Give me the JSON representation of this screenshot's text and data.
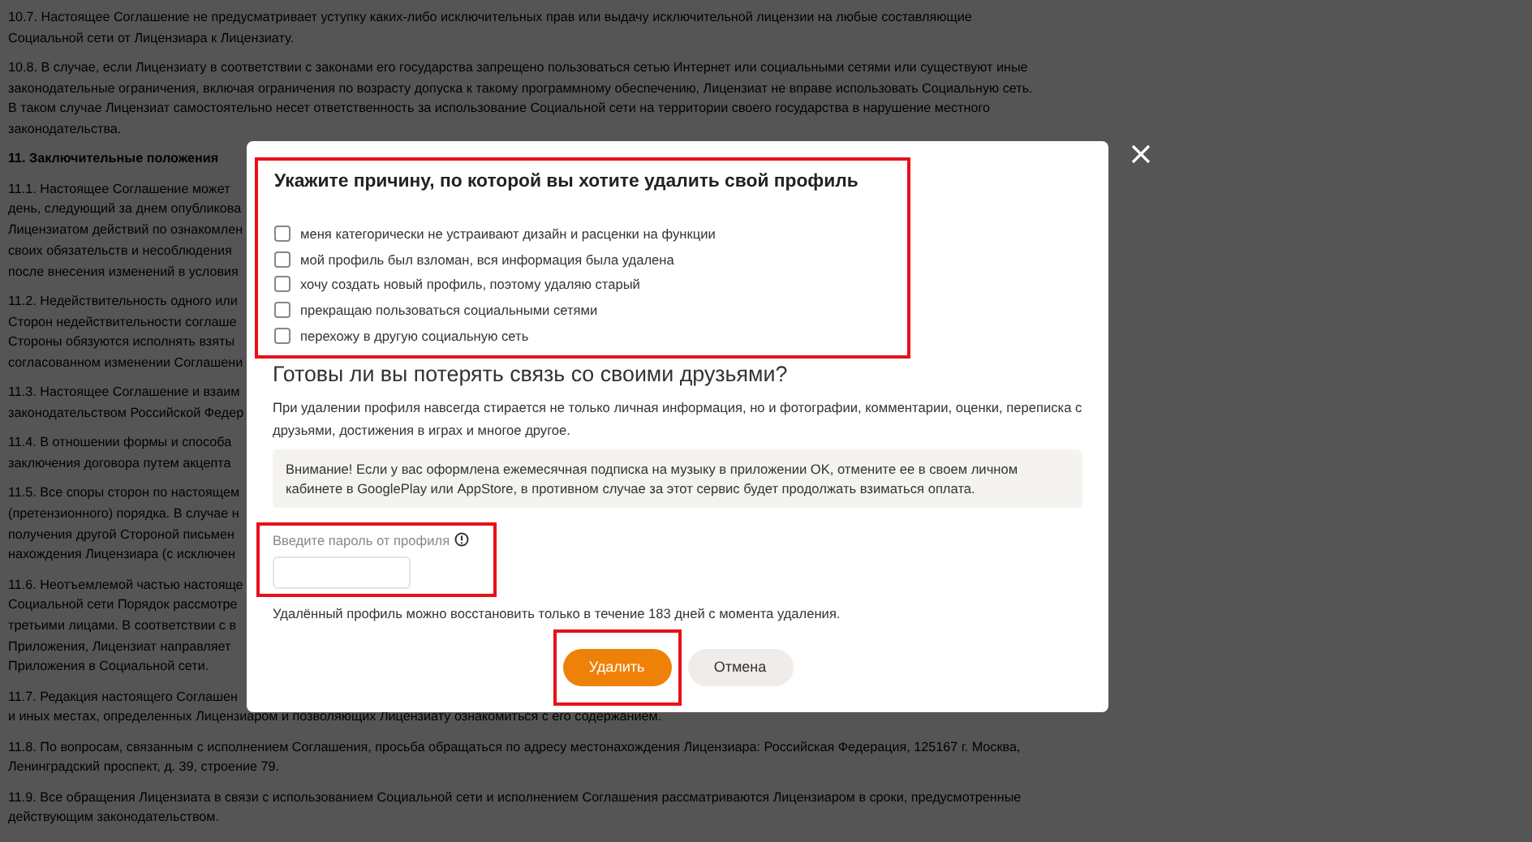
{
  "page": {
    "sections": [
      {
        "kind": "paragraph",
        "lines": [
          "10.7. Настоящее Соглашение не предусматривает уступку каких-либо исключительных прав или выдачу исключительной лицензии на любые составляющие",
          "Социальной сети от Лицензиара к Лицензиату."
        ]
      },
      {
        "kind": "paragraph",
        "lines": [
          "10.8. В случае, если Лицензиату в соответствии с законами его государства запрещено пользоваться сетью Интернет или социальными сетями или существуют иные",
          "законодательные ограничения, включая ограничения по возрасту допуска к такому программному обеспечению, Лицензиат не вправе использовать Социальную сеть.",
          "В таком случае Лицензиат самостоятельно несет ответственность за использование Социальной сети на территории своего государства в нарушение местного",
          "законодательства."
        ]
      },
      {
        "kind": "heading",
        "lines": [
          "11. Заключительные положения"
        ]
      },
      {
        "kind": "paragraph",
        "lines": [
          "11.1. Настоящее Соглашение может",
          "день, следующий за днем опубликова",
          "Лицензиатом действий по ознакомлен",
          "своих обязательств и несоблюдения",
          "после внесения изменений в условия"
        ]
      },
      {
        "kind": "paragraph",
        "lines": [
          "11.2. Недействительность одного или",
          "Сторон недействительности соглаше",
          "Стороны обязуются исполнять взяты",
          "согласованном изменении Соглашени"
        ]
      },
      {
        "kind": "paragraph",
        "lines": [
          "11.3. Настоящее Соглашение и взаим",
          "законодательством Российской Федер"
        ]
      },
      {
        "kind": "paragraph",
        "lines": [
          "11.4. В отношении формы и способа",
          "заключения договора путем акцепта"
        ]
      },
      {
        "kind": "paragraph",
        "lines": [
          "11.5. Все споры сторон по настоящем",
          "(претензионного) порядка. В случае н",
          "получения другой Стороной письмен",
          "нахождения Лицензиара (с исключен"
        ]
      },
      {
        "kind": "paragraph",
        "lines": [
          "11.6. Неотъемлемой частью настояще",
          "Социальной сети Порядок рассмотре",
          "третьими лицами. В соответствии с в",
          "Приложения, Лицензиат направляет",
          "Приложения в Социальной сети."
        ]
      },
      {
        "kind": "paragraph",
        "lines": [
          "11.7. Редакция настоящего Соглашен",
          "и иных местах, определенных Лицензиаром и позволяющих Лицензиату ознакомиться с его содержанием."
        ]
      },
      {
        "kind": "paragraph",
        "lines": [
          "11.8. По вопросам, связанным с исполнением Соглашения, просьба обращаться по адресу местонахождения Лицензиара: Российская Федерация, 125167 г. Москва,",
          "Ленинградский проспект, д. 39, строение 79."
        ]
      },
      {
        "kind": "paragraph",
        "lines": [
          "11.9. Все обращения Лицензиата в связи с использованием Социальной сети и исполнением Соглашения рассматриваются Лицензиаром в сроки, предусмотренные",
          "действующим законодательством."
        ]
      }
    ]
  },
  "dialog": {
    "reasons": {
      "highlighted": true,
      "title": "Укажите причину, по которой вы хотите удалить свой профиль",
      "options": [
        {
          "label": "меня категорически не устраивают дизайн и расценки на функции",
          "checked": false
        },
        {
          "label": "мой профиль был взломан, вся информация была удалена",
          "checked": false
        },
        {
          "label": "хочу создать новый профиль, поэтому удаляю старый",
          "checked": false
        },
        {
          "label": "прекращаю пользоваться социальными сетями",
          "checked": false
        },
        {
          "label": "перехожу в другую социальную сеть",
          "checked": false
        }
      ]
    },
    "question": "Готовы ли вы потерять связь со своими друзьями?",
    "description": "При удалении профиля навсегда стирается не только личная информация, но и фотографии, комментарии, оценки, переписка с друзьями, достижения в играх и многое другое.",
    "notice": "Внимание! Если у вас оформлена ежемесячная подписка на музыку в приложении OK, отмените ее в своем личном кабинете в GooglePlay или AppStore, в противном случае за этот сервис будет продолжать взиматься оплата.",
    "password": {
      "highlighted": true,
      "label": "Введите пароль от профиля"
    },
    "restore_note": "Удалённый профиль можно восстановить только в течение 183 дней с момента удаления.",
    "buttons": [
      {
        "kind": "primary",
        "label": "Удалить",
        "highlighted": true
      },
      {
        "kind": "secondary",
        "label": "Отмена",
        "highlighted": false
      }
    ]
  }
}
